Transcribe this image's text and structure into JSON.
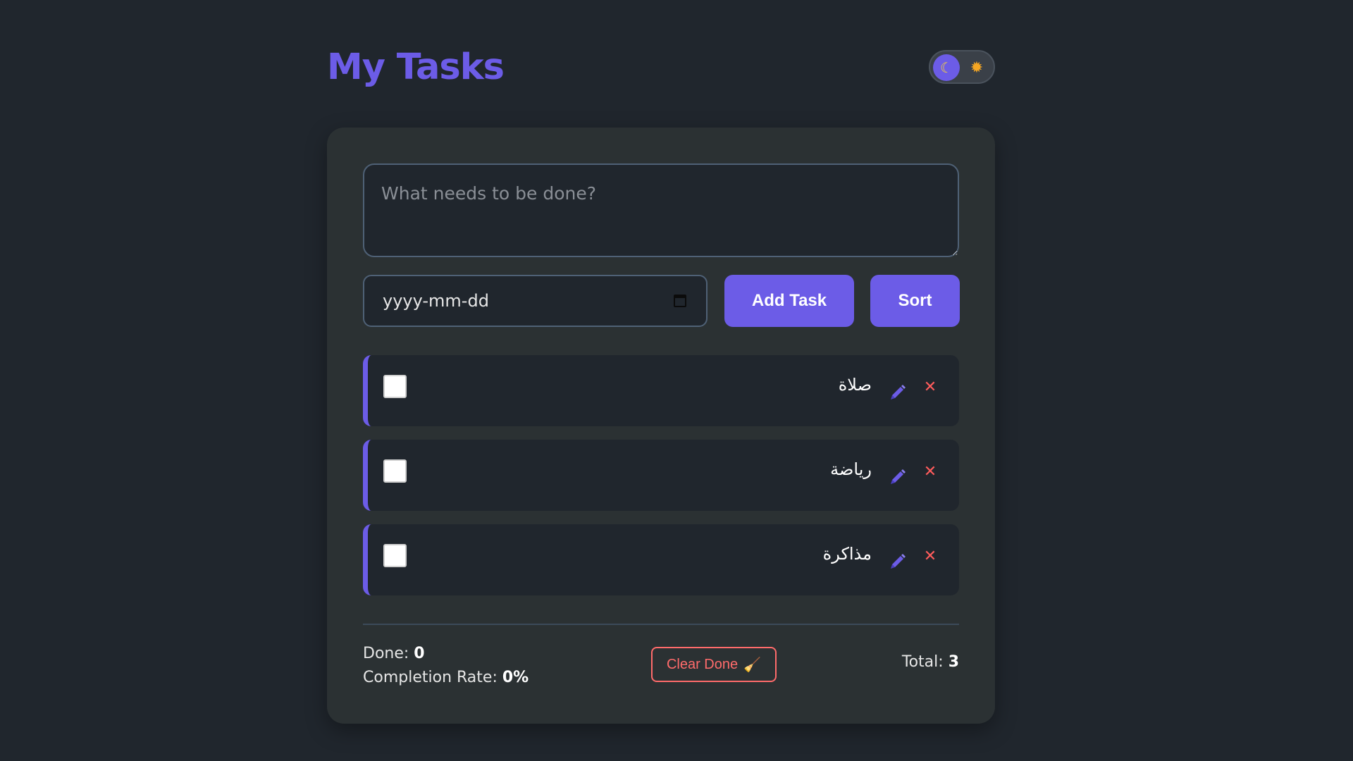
{
  "header": {
    "title": "My Tasks",
    "theme_toggle": {
      "moon_icon": "moon-icon",
      "sun_icon": "sun-icon",
      "mode": "dark"
    }
  },
  "form": {
    "task_placeholder": "What needs to be done?",
    "task_value": "",
    "date_placeholder": "yyyy-mm-dd",
    "add_label": "Add Task",
    "sort_label": "Sort"
  },
  "tasks": [
    {
      "text": "صلاة",
      "done": false
    },
    {
      "text": "رياضة",
      "done": false
    },
    {
      "text": "مذاكرة",
      "done": false
    }
  ],
  "footer": {
    "done_label": "Done:",
    "done_value": "0",
    "rate_label": "Completion Rate:",
    "rate_value": "0%",
    "clear_label": "Clear Done",
    "total_label": "Total:",
    "total_value": "3"
  },
  "colors": {
    "background": "#20262d",
    "card": "#2b3133",
    "accent": "#6c5ce7",
    "danger": "#ff6b6b"
  }
}
